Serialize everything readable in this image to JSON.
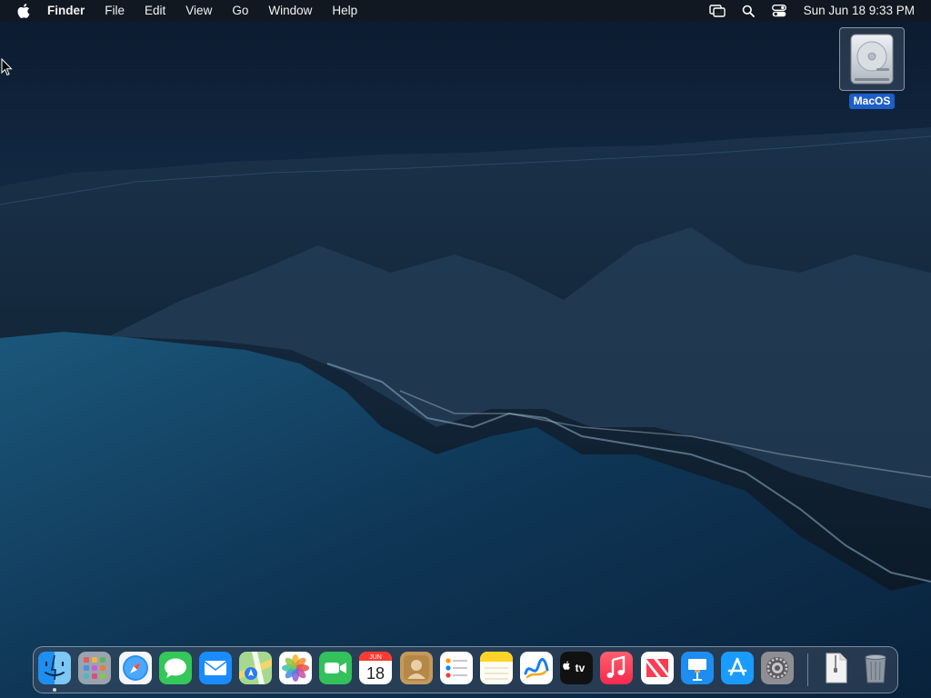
{
  "menubar": {
    "app_name": "Finder",
    "items": [
      "File",
      "Edit",
      "View",
      "Go",
      "Window",
      "Help"
    ],
    "clock": "Sun Jun 18  9:33 PM",
    "status_icons": [
      "screen-mirroring-icon",
      "search-icon",
      "control-center-icon"
    ]
  },
  "desktop": {
    "disk": {
      "label": "MacOS",
      "icon": "hard-drive-icon"
    }
  },
  "dock": {
    "apps": [
      {
        "name": "Finder",
        "icon": "finder-icon",
        "running": true
      },
      {
        "name": "Launchpad",
        "icon": "launchpad-icon"
      },
      {
        "name": "Safari",
        "icon": "safari-icon"
      },
      {
        "name": "Messages",
        "icon": "messages-icon"
      },
      {
        "name": "Mail",
        "icon": "mail-icon"
      },
      {
        "name": "Maps",
        "icon": "maps-icon"
      },
      {
        "name": "Photos",
        "icon": "photos-icon"
      },
      {
        "name": "FaceTime",
        "icon": "facetime-icon"
      },
      {
        "name": "Calendar",
        "icon": "calendar-icon"
      },
      {
        "name": "Contacts",
        "icon": "contacts-icon"
      },
      {
        "name": "Reminders",
        "icon": "reminders-icon"
      },
      {
        "name": "Notes",
        "icon": "notes-icon"
      },
      {
        "name": "Freeform",
        "icon": "freeform-icon"
      },
      {
        "name": "TV",
        "icon": "appletv-icon"
      },
      {
        "name": "Music",
        "icon": "music-icon"
      },
      {
        "name": "News",
        "icon": "news-icon"
      },
      {
        "name": "Keynote",
        "icon": "keynote-icon"
      },
      {
        "name": "App Store",
        "icon": "appstore-icon"
      },
      {
        "name": "System Settings",
        "icon": "settings-icon"
      }
    ],
    "calendar_month": "JUN",
    "calendar_day": "18",
    "tv_text": "tv",
    "others": [
      {
        "name": "Archive",
        "icon": "archive-file-icon"
      },
      {
        "name": "Trash",
        "icon": "trash-icon"
      }
    ]
  }
}
